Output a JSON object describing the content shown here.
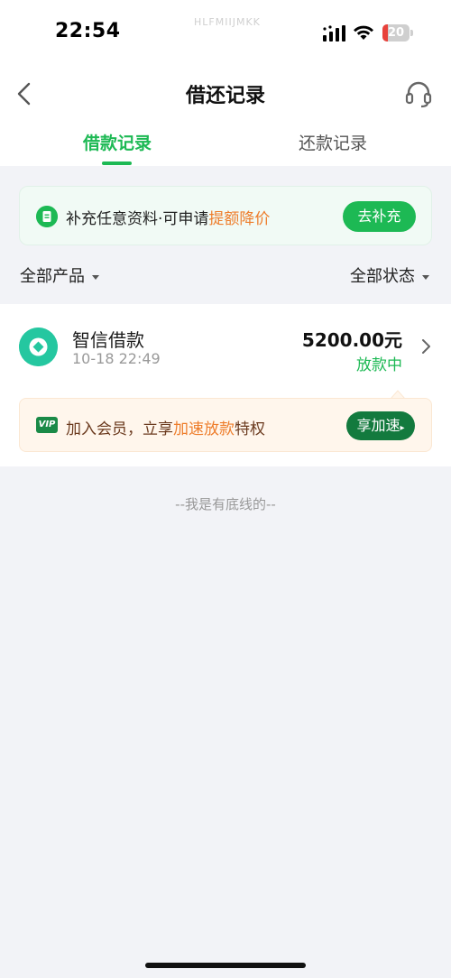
{
  "status_bar": {
    "time": "22:54",
    "carrier_text": "HLFMIIJMKK",
    "battery_level": "20",
    "battery_fraction": 0.2
  },
  "nav": {
    "title": "借还记录",
    "back_icon": "chevron-left-icon",
    "support_icon": "headset-icon"
  },
  "tabs": [
    {
      "label": "借款记录",
      "active": true
    },
    {
      "label": "还款记录",
      "active": false
    }
  ],
  "banner": {
    "text": "补充任意资料·可申请",
    "highlight": "提额降价",
    "button_label": "去补充"
  },
  "filters": {
    "product_label": "全部产品",
    "status_label": "全部状态"
  },
  "loans": [
    {
      "name": "智信借款",
      "time": "10-18 22:49",
      "amount": "5200.00元",
      "status": "放款中"
    }
  ],
  "vip": {
    "badge": "VIP",
    "text_prefix": "加入会员，立享",
    "highlight": "加速放款",
    "text_suffix": "特权",
    "button_label": "享加速",
    "button_arrow": "▸"
  },
  "footer": {
    "text": "--我是有底线的--"
  },
  "colors": {
    "accent": "#1db954",
    "highlight_orange": "#ee7d2b",
    "background": "#f2f3f7",
    "vip_green": "#137a3e",
    "battery_red": "#e8423b"
  }
}
